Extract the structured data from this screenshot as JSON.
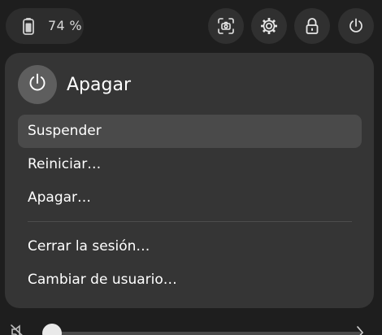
{
  "status": {
    "battery_text": "74 %",
    "battery_level": 0.74
  },
  "icons": {
    "battery": "battery-icon",
    "screenshot": "screenshot-icon",
    "settings": "settings-gear-icon",
    "lock": "lock-icon",
    "power": "power-icon",
    "volume_muted": "volume-muted-icon",
    "chevron": "chevron-right-icon"
  },
  "power_menu": {
    "title": "Apagar",
    "items": [
      {
        "label": "Suspender"
      },
      {
        "label": "Reiniciar…"
      },
      {
        "label": "Apagar…"
      },
      {
        "label": "Cerrar la sesión…"
      },
      {
        "label": "Cambiar de usuario…"
      }
    ]
  },
  "volume": {
    "level": 0.0
  },
  "colors": {
    "background": "#1e1e1e",
    "panel": "#353535",
    "button": "#303030",
    "hover": "#4a4a4a",
    "text": "#ffffff"
  }
}
